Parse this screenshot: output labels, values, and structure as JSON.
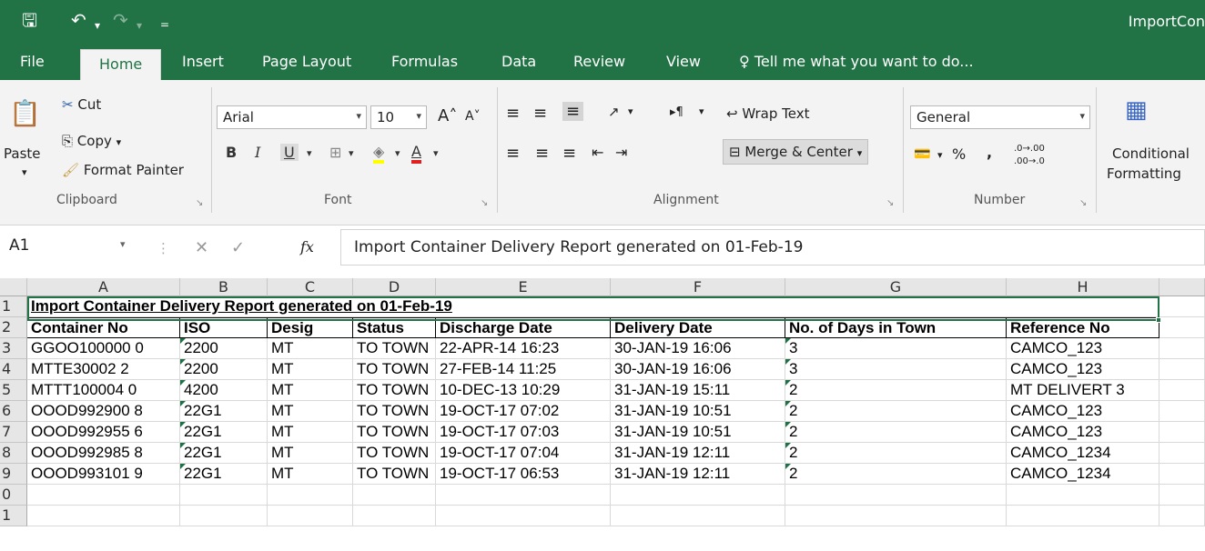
{
  "title_bar": {
    "doc_title": "ImportCon"
  },
  "tabs": [
    "File",
    "Home",
    "Insert",
    "Page Layout",
    "Formulas",
    "Data",
    "Review",
    "View"
  ],
  "tell_me": "Tell me what you want to do...",
  "clipboard": {
    "paste": "Paste",
    "cut": "Cut",
    "copy": "Copy",
    "format_painter": "Format Painter",
    "label": "Clipboard"
  },
  "font": {
    "name": "Arial",
    "size": "10",
    "bold": "B",
    "italic": "I",
    "underline": "U",
    "grow": "A",
    "shrink": "A",
    "color_a": "A",
    "label": "Font"
  },
  "alignment": {
    "wrap": "Wrap Text",
    "merge": "Merge & Center",
    "label": "Alignment"
  },
  "number": {
    "format": "General",
    "percent": "%",
    "comma": ",",
    "inc": ".0→.00",
    "dec": ".00→.0",
    "label": "Number"
  },
  "styles": {
    "conditional": "Conditional",
    "formatting": "Formatting"
  },
  "formula_bar": {
    "name_box": "A1",
    "fx": "fx",
    "formula": "Import Container Delivery Report generated on 01-Feb-19"
  },
  "grid": {
    "columns": [
      "A",
      "B",
      "C",
      "D",
      "E",
      "F",
      "G",
      "H"
    ],
    "rows": [
      "1",
      "2",
      "3",
      "4",
      "5",
      "6",
      "7",
      "8",
      "9",
      "0",
      "1"
    ],
    "title": "Import Container Delivery Report generated on 01-Feb-19",
    "headers": [
      "Container No",
      "ISO",
      "Desig",
      "Status",
      "Discharge Date",
      "Delivery Date",
      "No. of Days in Town",
      "Reference No"
    ],
    "data": [
      [
        "GGOO100000 0",
        "2200",
        "MT",
        "TO TOWN",
        "22-APR-14 16:23",
        "30-JAN-19 16:06",
        "3",
        "CAMCO_123"
      ],
      [
        "MTTE30002 2",
        "2200",
        "MT",
        "TO TOWN",
        "27-FEB-14 11:25",
        "30-JAN-19 16:06",
        "3",
        "CAMCO_123"
      ],
      [
        "MTTT100004 0",
        "4200",
        "MT",
        "TO TOWN",
        "10-DEC-13 10:29",
        "31-JAN-19 15:11",
        "2",
        "MT DELIVERT 3"
      ],
      [
        "OOOD992900 8",
        "22G1",
        "MT",
        "TO TOWN",
        "19-OCT-17 07:02",
        "31-JAN-19 10:51",
        "2",
        "CAMCO_123"
      ],
      [
        "OOOD992955 6",
        "22G1",
        "MT",
        "TO TOWN",
        "19-OCT-17 07:03",
        "31-JAN-19 10:51",
        "2",
        "CAMCO_123"
      ],
      [
        "OOOD992985 8",
        "22G1",
        "MT",
        "TO TOWN",
        "19-OCT-17 07:04",
        "31-JAN-19 12:11",
        "2",
        "CAMCO_1234"
      ],
      [
        "OOOD993101 9",
        "22G1",
        "MT",
        "TO TOWN",
        "19-OCT-17 06:53",
        "31-JAN-19 12:11",
        "2",
        "CAMCO_1234"
      ]
    ]
  },
  "colors": {
    "excel_green": "#217346",
    "ribbon_bg": "#f3f3f3",
    "header_bg": "#e6e6e6"
  }
}
